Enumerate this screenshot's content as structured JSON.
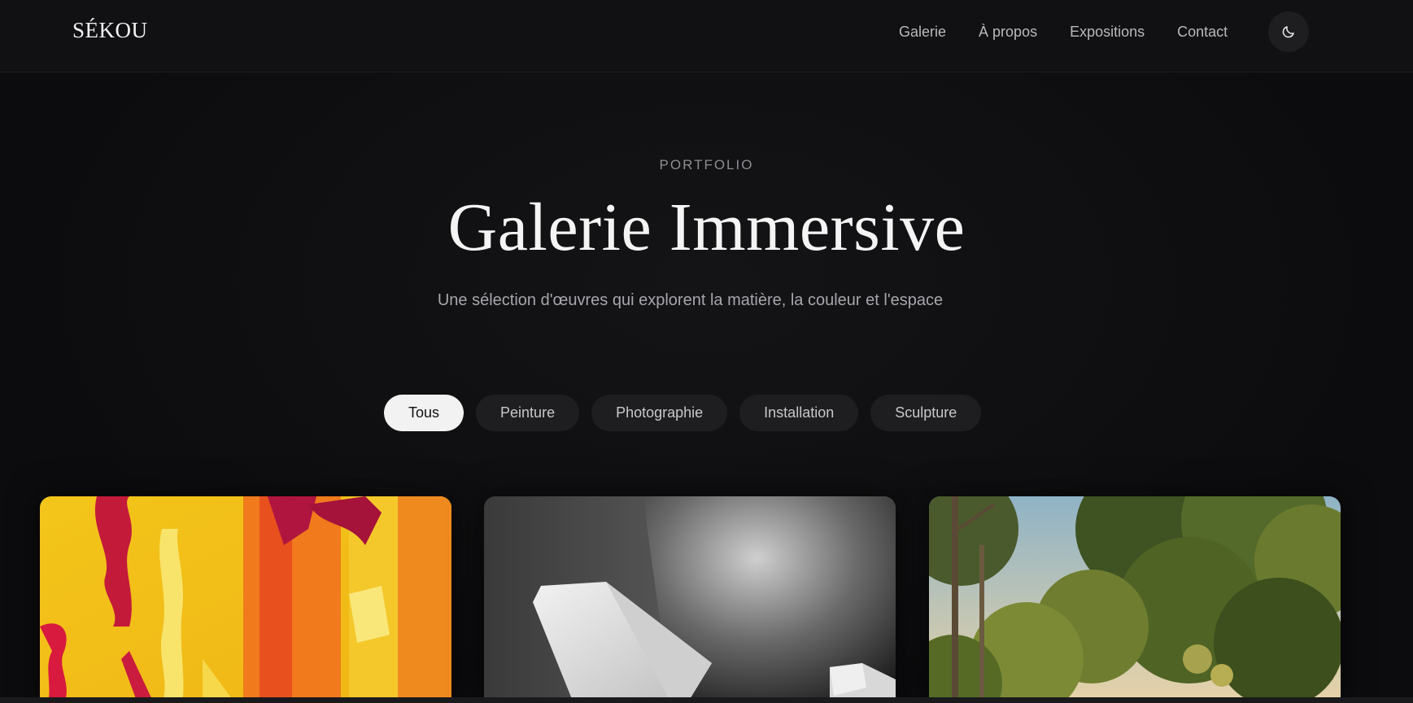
{
  "header": {
    "logo": "SÉKOU",
    "nav": [
      "Galerie",
      "À propos",
      "Expositions",
      "Contact"
    ],
    "theme_toggle_icon": "moon-icon"
  },
  "hero": {
    "eyebrow": "PORTFOLIO",
    "title": "Galerie Immersive",
    "subtitle": "Une sélection d'œuvres qui explorent la matière, la couleur et l'espace"
  },
  "filters": {
    "items": [
      "Tous",
      "Peinture",
      "Photographie",
      "Installation",
      "Sculpture"
    ],
    "active": "Tous"
  },
  "gallery": {
    "cards": [
      {
        "artwork": "abstract-painting"
      },
      {
        "artwork": "geometric-sculpture-photo"
      },
      {
        "artwork": "landscape-painting"
      }
    ]
  },
  "colors": {
    "background": "#0e0e10",
    "chip": "#1e1e21",
    "chip_active": "#f2f2f2"
  }
}
